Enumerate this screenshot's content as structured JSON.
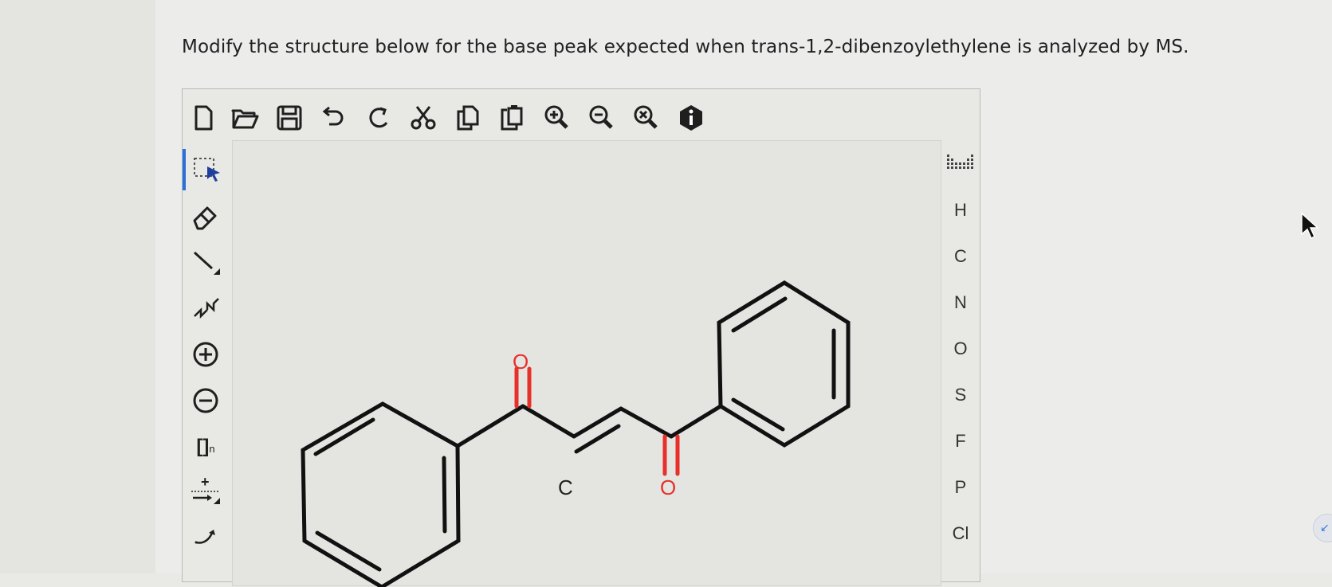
{
  "question": {
    "text": "Modify the structure below for the base peak expected when trans-1,2-dibenzoylethylene is analyzed by MS."
  },
  "toolbar": {
    "icons": [
      "new-document-icon",
      "open-folder-icon",
      "save-icon",
      "undo-icon",
      "redo-icon",
      "cut-icon",
      "copy-icon",
      "paste-icon",
      "zoom-in-icon",
      "zoom-out-icon",
      "zoom-reset-icon",
      "info-icon"
    ]
  },
  "left_tools": {
    "icons": [
      "select-lasso-icon",
      "eraser-icon",
      "single-bond-icon",
      "chain-icon",
      "add-charge-icon",
      "remove-charge-icon",
      "bracket-icon",
      "reaction-arrow-icon",
      "curved-arrow-icon"
    ],
    "bracket_label": "[]",
    "bracket_sub": "n",
    "arrow_plus": "+"
  },
  "molecule": {
    "atom_labels": {
      "o_left": "O",
      "o_right": "O",
      "c_label": "C"
    },
    "colors": {
      "oxygen": "#e8302a",
      "bond": "#111111",
      "carbon_label": "#222222"
    }
  },
  "elements": {
    "items": [
      "H",
      "C",
      "N",
      "O",
      "S",
      "F",
      "P",
      "Cl"
    ]
  },
  "colors": {
    "accent": "#2a6fdb",
    "icon": "#1f1f1f"
  }
}
